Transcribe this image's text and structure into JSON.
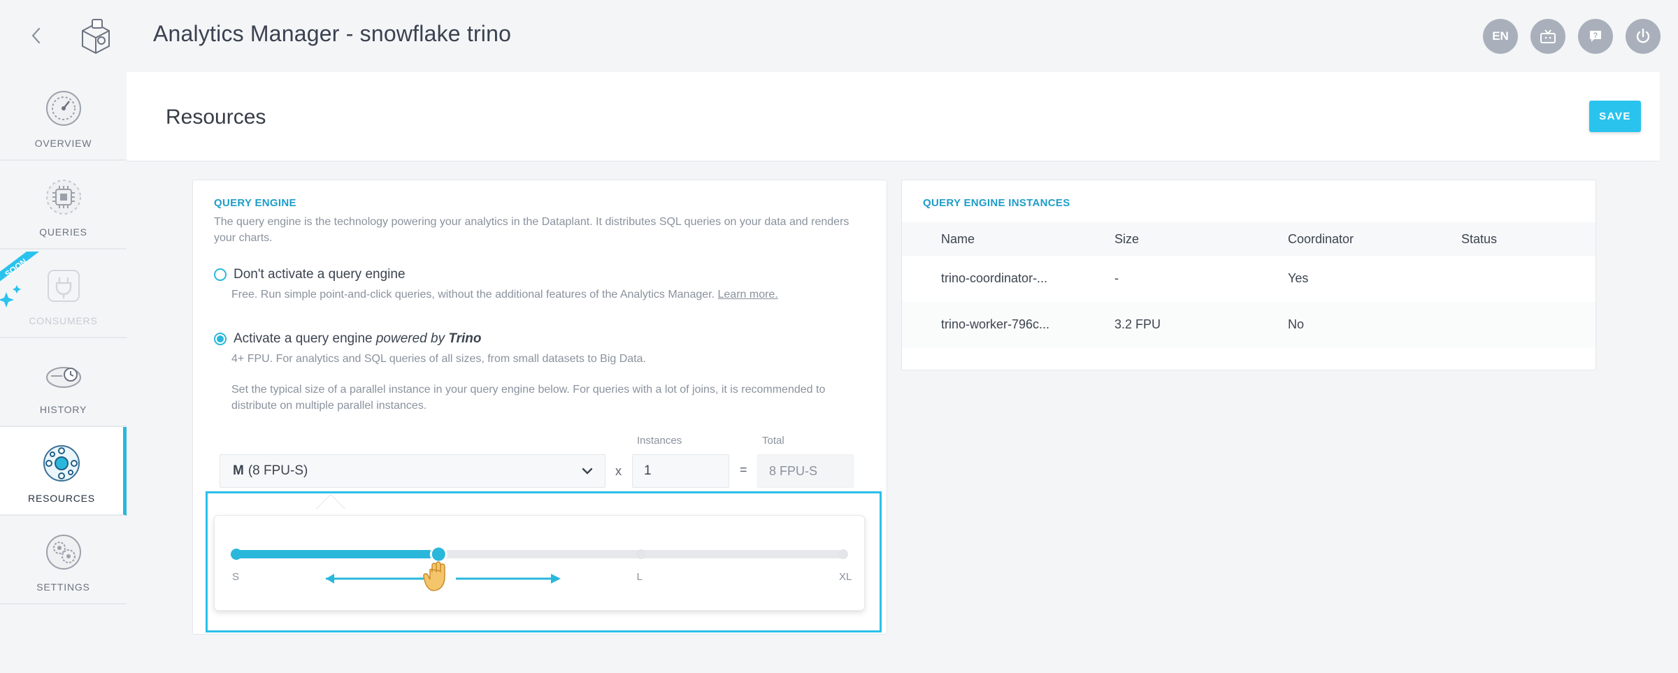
{
  "app": {
    "title": "Analytics Manager - snowflake trino",
    "language": "EN"
  },
  "sidebar": {
    "items": [
      {
        "label": "OVERVIEW",
        "icon": "gauge-icon"
      },
      {
        "label": "QUERIES",
        "icon": "chip-icon"
      },
      {
        "label": "CONSUMERS",
        "icon": "plug-icon",
        "badge": "SOON"
      },
      {
        "label": "HISTORY",
        "icon": "history-icon"
      },
      {
        "label": "RESOURCES",
        "icon": "resources-icon"
      },
      {
        "label": "SETTINGS",
        "icon": "settings-icon"
      }
    ]
  },
  "page": {
    "title": "Resources",
    "save_label": "SAVE"
  },
  "query_engine": {
    "heading": "QUERY ENGINE",
    "description": "The query engine is the technology powering your analytics in the Dataplant. It distributes SQL queries on your data and renders your charts.",
    "option_none": {
      "label": "Don't activate a query engine",
      "sub": "Free. Run simple point-and-click queries, without the additional features of the Analytics Manager.",
      "link": "Learn more."
    },
    "option_trino": {
      "label_prefix": "Activate a query engine ",
      "label_powered": "powered by ",
      "label_brand": "Trino",
      "sub1": "4+ FPU. For analytics and SQL queries of all sizes, from small datasets to Big Data.",
      "sub2": "Set the typical size of a parallel instance in your query engine below. For queries with a lot of joins, it is recommended to distribute on multiple parallel instances."
    },
    "size_select": {
      "size": "M",
      "detail": "(8 FPU-S)"
    },
    "instances_label": "Instances",
    "instances_value": "1",
    "total_label": "Total",
    "total_value": "8 FPU-S",
    "times": "x",
    "equals": "=",
    "slider": {
      "ticks": [
        "S",
        "",
        "L",
        "XL"
      ],
      "selected_index": 1,
      "steps": 4
    }
  },
  "instances": {
    "heading": "QUERY ENGINE INSTANCES",
    "columns": [
      "Name",
      "Size",
      "Coordinator",
      "Status"
    ],
    "rows": [
      {
        "name": "trino-coordinator-...",
        "size": "-",
        "coordinator": "Yes",
        "status": ""
      },
      {
        "name": "trino-worker-796c...",
        "size": "3.2 FPU",
        "coordinator": "No",
        "status": ""
      }
    ]
  },
  "colors": {
    "accent": "#2ab7dc",
    "heading": "#1e9dc8",
    "save": "#2ac3ee"
  }
}
